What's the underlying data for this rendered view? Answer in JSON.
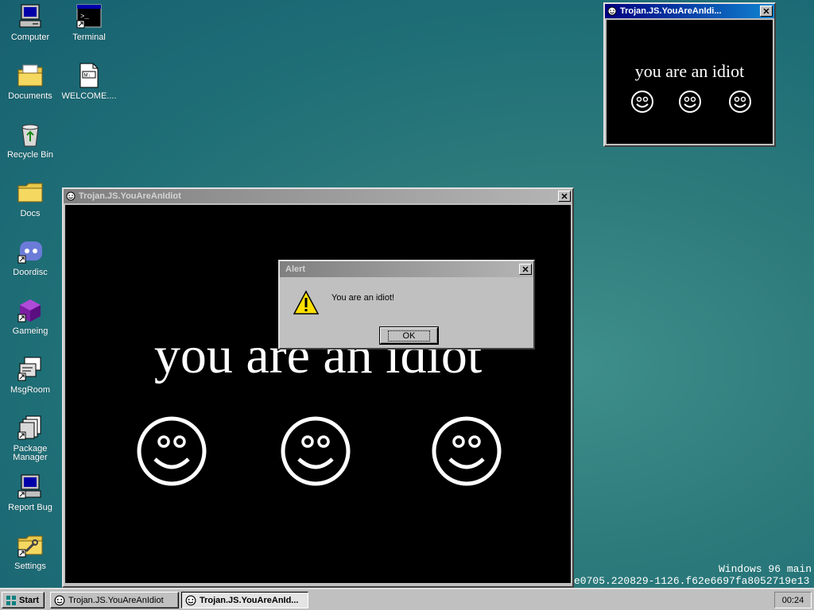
{
  "desktop": {
    "icons": [
      {
        "label": "Computer",
        "icon": "computer-icon"
      },
      {
        "label": "Terminal",
        "icon": "terminal-icon"
      },
      {
        "label": "Documents",
        "icon": "documents-folder-icon"
      },
      {
        "label": "WELCOME....",
        "icon": "markdown-file-icon"
      },
      {
        "label": "Recycle Bin",
        "icon": "recycle-bin-icon"
      },
      {
        "label": "Docs",
        "icon": "folder-icon"
      },
      {
        "label": "Doordisc",
        "icon": "doordisc-icon"
      },
      {
        "label": "Gameing",
        "icon": "cube-icon"
      },
      {
        "label": "MsgRoom",
        "icon": "msgroom-icon"
      },
      {
        "label": "Package Manager",
        "icon": "package-manager-icon"
      },
      {
        "label": "Report Bug",
        "icon": "report-bug-icon"
      },
      {
        "label": "Settings",
        "icon": "settings-icon"
      }
    ]
  },
  "small_window": {
    "title": "Trojan.JS.YouAreAnIdi...",
    "text": "you are an idiot"
  },
  "main_window": {
    "title": "Trojan.JS.YouAreAnIdiot",
    "text": "you are an idiot"
  },
  "alert": {
    "title": "Alert",
    "message": "You are an idiot!",
    "ok_label": "OK"
  },
  "watermark": {
    "line1": "Windows 96 main",
    "line2": "e0705.220829-1126.f62e6697fa8052719e13"
  },
  "taskbar": {
    "start_label": "Start",
    "tasks": [
      {
        "label": "Trojan.JS.YouAreAnIdiot",
        "pressed": false
      },
      {
        "label": "Trojan.JS.YouAreAnId...",
        "pressed": true
      }
    ],
    "clock": "00:24"
  }
}
